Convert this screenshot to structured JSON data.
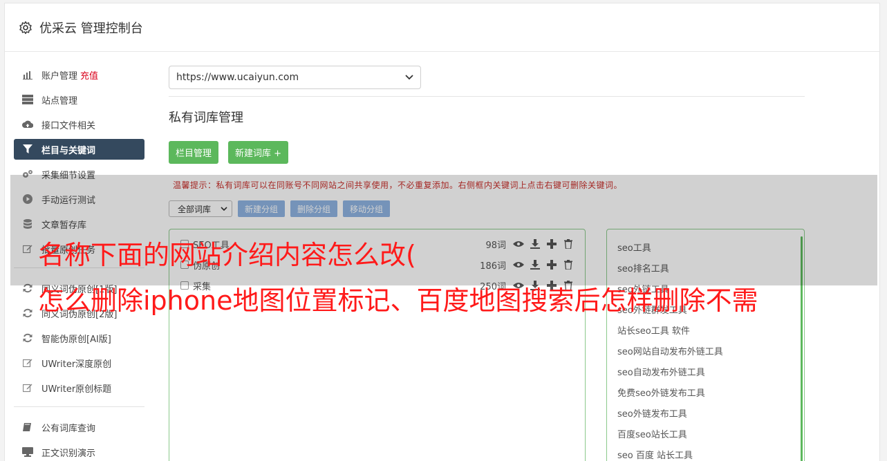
{
  "header": {
    "title": "优采云 管理控制台"
  },
  "sidebar": {
    "items": [
      {
        "label": "账户管理",
        "badge": "充值",
        "icon": "bar-chart-icon"
      },
      {
        "label": "站点管理",
        "icon": "server-icon"
      },
      {
        "label": "接口文件相关",
        "icon": "cloud-upload-icon"
      },
      {
        "label": "栏目与关键词",
        "icon": "filter-icon",
        "active": true
      },
      {
        "label": "采集细节设置",
        "icon": "gears-icon"
      },
      {
        "label": "手动运行测试",
        "icon": "play-circle-icon"
      },
      {
        "label": "文章暂存库",
        "icon": "database-icon"
      },
      {
        "label": "批量原创任务",
        "icon": "edit-icon"
      }
    ],
    "items2": [
      {
        "label": "同义词伪原创[1版]",
        "icon": "refresh-icon"
      },
      {
        "label": "同义词伪原创[2版]",
        "icon": "refresh-icon"
      },
      {
        "label": "智能伪原创[AI版]",
        "icon": "refresh-icon"
      },
      {
        "label": "UWriter深度原创",
        "icon": "edit-icon"
      },
      {
        "label": "UWriter原创标题",
        "icon": "edit-icon"
      }
    ],
    "items3": [
      {
        "label": "公有词库查询",
        "icon": "book-icon"
      },
      {
        "label": "正文识别演示",
        "icon": "monitor-icon"
      }
    ]
  },
  "main": {
    "site_select": "https://www.ucaiyun.com",
    "section_title": "私有词库管理",
    "btn_columns": "栏目管理",
    "btn_new_lib": "新建词库 +",
    "tip": "温馨提示：私有词库可以在同账号不同网站之间共享使用，不必重复添加。右侧框内关键词上点击右键可删除关键词。",
    "filter_select": "全部词库",
    "btn_new_group": "新建分组",
    "btn_delete_group": "删除分组",
    "btn_move_group": "移动分组",
    "libraries": [
      {
        "name": "SEO工具",
        "count": "98词"
      },
      {
        "name": "伪原创",
        "count": "186词"
      },
      {
        "name": "采集",
        "count": "250词"
      }
    ],
    "keywords": [
      "seo工具",
      "seo排名工具",
      "seo外链工具",
      "seo外链群发工具",
      "站长seo工具 软件",
      "seo网站自动发布外链工具",
      "seo自动发布外链工具",
      "免费seo外链发布工具",
      "seo外链发布工具",
      "百度seo站长工具",
      "seo 百度 站长工具"
    ]
  },
  "overlay": {
    "line1": "名称下面的网站介绍内容怎么改(",
    "line2": "怎么删除iphone地图位置标记、百度地图搜索后怎样删除不需"
  },
  "colors": {
    "active_nav": "#34495e",
    "green": "#5cb85c",
    "blue": "#8fb4e2",
    "tip": "#c9302c",
    "overlay_text": "#ff1a1a"
  }
}
